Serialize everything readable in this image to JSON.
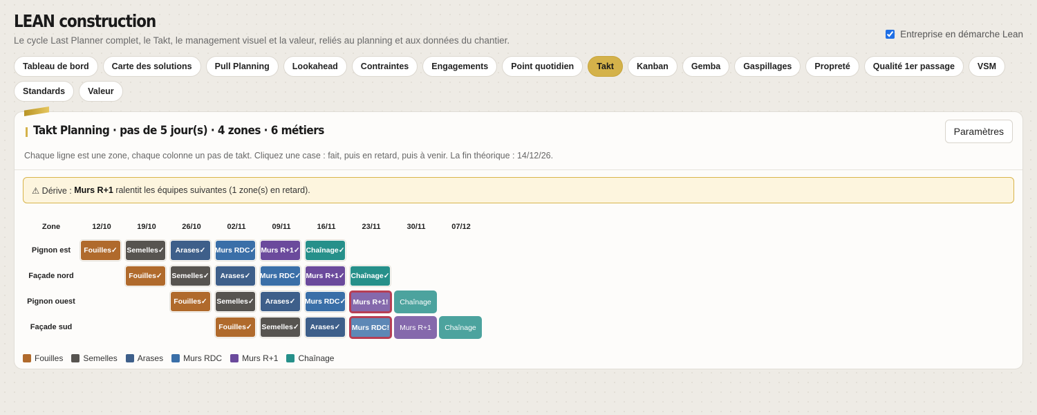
{
  "app": {
    "title": "LEAN construction",
    "subtitle": "Le cycle Last Planner complet, le Takt, le management visuel et la valeur, reliés au planning et aux données du chantier.",
    "lean_toggle_label": "Entreprise en démarche Lean",
    "lean_toggle_checked": true
  },
  "tabs": [
    {
      "label": "Tableau de bord",
      "active": false
    },
    {
      "label": "Carte des solutions",
      "active": false
    },
    {
      "label": "Pull Planning",
      "active": false
    },
    {
      "label": "Lookahead",
      "active": false
    },
    {
      "label": "Contraintes",
      "active": false
    },
    {
      "label": "Engagements",
      "active": false
    },
    {
      "label": "Point quotidien",
      "active": false
    },
    {
      "label": "Takt",
      "active": true
    },
    {
      "label": "Kanban",
      "active": false
    },
    {
      "label": "Gemba",
      "active": false
    },
    {
      "label": "Gaspillages",
      "active": false
    },
    {
      "label": "Propreté",
      "active": false
    },
    {
      "label": "Qualité 1er passage",
      "active": false
    },
    {
      "label": "VSM",
      "active": false
    },
    {
      "label": "Standards",
      "active": false
    },
    {
      "label": "Valeur",
      "active": false
    }
  ],
  "card": {
    "title": "Takt Planning · pas de 5 jour(s) · 4 zones · 6 métiers",
    "description": "Chaque ligne est une zone, chaque colonne un pas de takt. Cliquez une case : fait, puis en retard, puis à venir. La fin théorique : 14/12/26.",
    "params_label": "Paramètres"
  },
  "alert": {
    "prefix": "⚠ Dérive : ",
    "trade": "Murs R+1",
    "suffix": " ralentit les équipes suivantes (1 zone(s) en retard)."
  },
  "colors": {
    "Fouilles": "#b06a2c",
    "Semelles": "#575450",
    "Arases": "#3e5f8a",
    "Murs RDC": "#3a6fa8",
    "Murs R+1": "#6b4a9c",
    "Chaînage": "#26908a",
    "late_border": "#a81530",
    "accent": "#d4b24a"
  },
  "takt": {
    "zone_header": "Zone",
    "steps": [
      "12/10",
      "19/10",
      "26/10",
      "02/11",
      "09/11",
      "16/11",
      "23/11",
      "30/11",
      "07/12"
    ],
    "zones": [
      {
        "name": "Pignon est",
        "cells": [
          {
            "step": 0,
            "trade": "Fouilles",
            "label": "Fouilles✓",
            "status": "done"
          },
          {
            "step": 1,
            "trade": "Semelles",
            "label": "Semelles✓",
            "status": "done"
          },
          {
            "step": 2,
            "trade": "Arases",
            "label": "Arases✓",
            "status": "done"
          },
          {
            "step": 3,
            "trade": "Murs RDC",
            "label": "Murs RDC✓",
            "status": "done"
          },
          {
            "step": 4,
            "trade": "Murs R+1",
            "label": "Murs R+1✓",
            "status": "done"
          },
          {
            "step": 5,
            "trade": "Chaînage",
            "label": "Chaînage✓",
            "status": "done"
          }
        ]
      },
      {
        "name": "Façade nord",
        "cells": [
          {
            "step": 1,
            "trade": "Fouilles",
            "label": "Fouilles✓",
            "status": "done"
          },
          {
            "step": 2,
            "trade": "Semelles",
            "label": "Semelles✓",
            "status": "done"
          },
          {
            "step": 3,
            "trade": "Arases",
            "label": "Arases✓",
            "status": "done"
          },
          {
            "step": 4,
            "trade": "Murs RDC",
            "label": "Murs RDC✓",
            "status": "done"
          },
          {
            "step": 5,
            "trade": "Murs R+1",
            "label": "Murs R+1✓",
            "status": "done"
          },
          {
            "step": 6,
            "trade": "Chaînage",
            "label": "Chaînage✓",
            "status": "done"
          }
        ]
      },
      {
        "name": "Pignon ouest",
        "cells": [
          {
            "step": 2,
            "trade": "Fouilles",
            "label": "Fouilles✓",
            "status": "done"
          },
          {
            "step": 3,
            "trade": "Semelles",
            "label": "Semelles✓",
            "status": "done"
          },
          {
            "step": 4,
            "trade": "Arases",
            "label": "Arases✓",
            "status": "done"
          },
          {
            "step": 5,
            "trade": "Murs RDC",
            "label": "Murs RDC✓",
            "status": "done"
          },
          {
            "step": 6,
            "trade": "Murs R+1",
            "label": "Murs R+1!",
            "status": "late"
          },
          {
            "step": 7,
            "trade": "Chaînage",
            "label": "Chaînage",
            "status": "todo"
          }
        ]
      },
      {
        "name": "Façade sud",
        "cells": [
          {
            "step": 3,
            "trade": "Fouilles",
            "label": "Fouilles✓",
            "status": "done"
          },
          {
            "step": 4,
            "trade": "Semelles",
            "label": "Semelles✓",
            "status": "done"
          },
          {
            "step": 5,
            "trade": "Arases",
            "label": "Arases✓",
            "status": "done"
          },
          {
            "step": 6,
            "trade": "Murs RDC",
            "label": "Murs RDC!",
            "status": "late"
          },
          {
            "step": 7,
            "trade": "Murs R+1",
            "label": "Murs R+1",
            "status": "todo"
          },
          {
            "step": 8,
            "trade": "Chaînage",
            "label": "Chaînage",
            "status": "todo"
          }
        ]
      }
    ]
  },
  "legend": [
    {
      "label": "Fouilles"
    },
    {
      "label": "Semelles"
    },
    {
      "label": "Arases"
    },
    {
      "label": "Murs RDC"
    },
    {
      "label": "Murs R+1"
    },
    {
      "label": "Chaînage"
    }
  ]
}
